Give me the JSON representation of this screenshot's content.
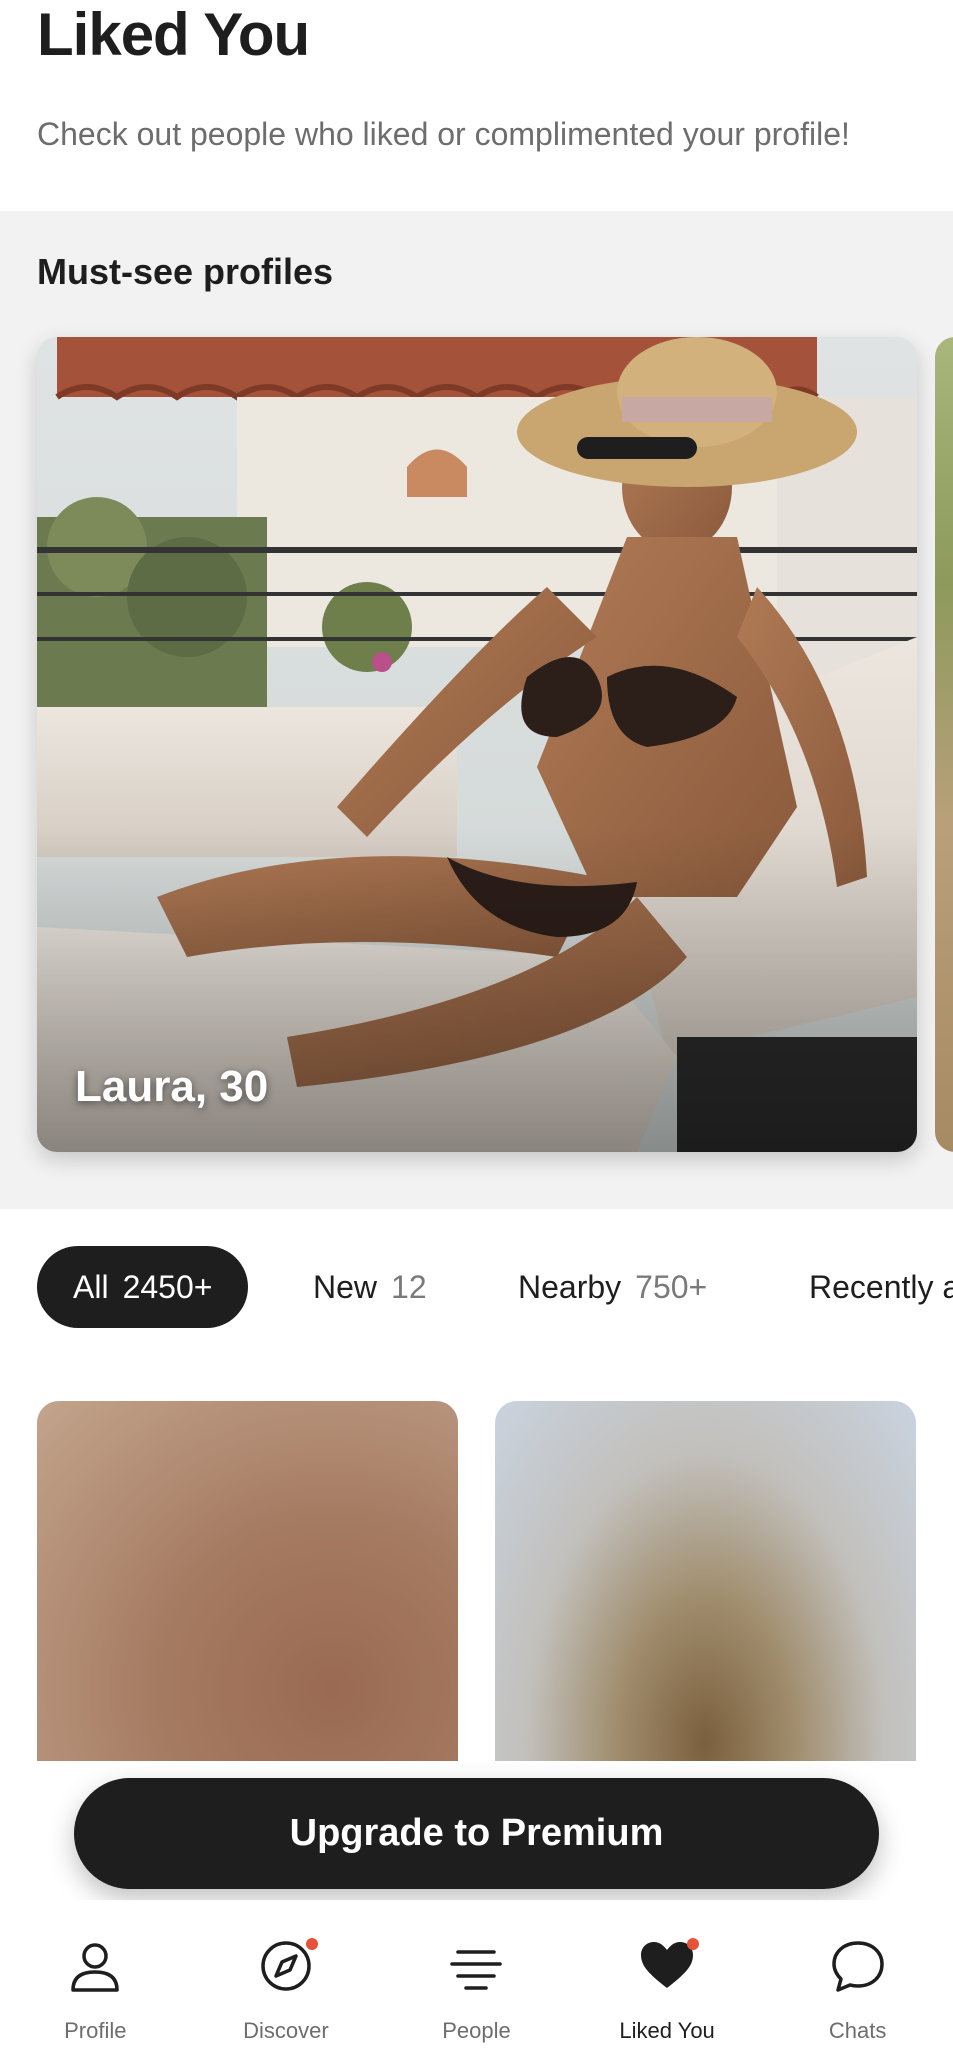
{
  "header": {
    "title": "Liked You",
    "subtitle": "Check out people who liked or complimented your profile!"
  },
  "must_see": {
    "title": "Must-see profiles",
    "featured": {
      "name_age": "Laura, 30"
    }
  },
  "filters": [
    {
      "label": "All",
      "count": "2450+",
      "active": true
    },
    {
      "label": "New",
      "count": "12",
      "active": false
    },
    {
      "label": "Nearby",
      "count": "750+",
      "active": false
    },
    {
      "label": "Recently active",
      "count": "",
      "active": false
    }
  ],
  "upgrade_button": {
    "label": "Upgrade to Premium"
  },
  "nav": {
    "items": [
      {
        "label": "Profile",
        "icon": "person-icon",
        "active": false,
        "dot": false
      },
      {
        "label": "Discover",
        "icon": "compass-icon",
        "active": false,
        "dot": true
      },
      {
        "label": "People",
        "icon": "list-icon",
        "active": false,
        "dot": false
      },
      {
        "label": "Liked You",
        "icon": "heart-icon",
        "active": true,
        "dot": true
      },
      {
        "label": "Chats",
        "icon": "chat-bubble-icon",
        "active": false,
        "dot": false
      }
    ]
  },
  "colors": {
    "text": "#1e1e1e",
    "subtext": "#6d6d6d",
    "section_bg": "#f2f2f2",
    "notification_dot": "#e5533a"
  }
}
